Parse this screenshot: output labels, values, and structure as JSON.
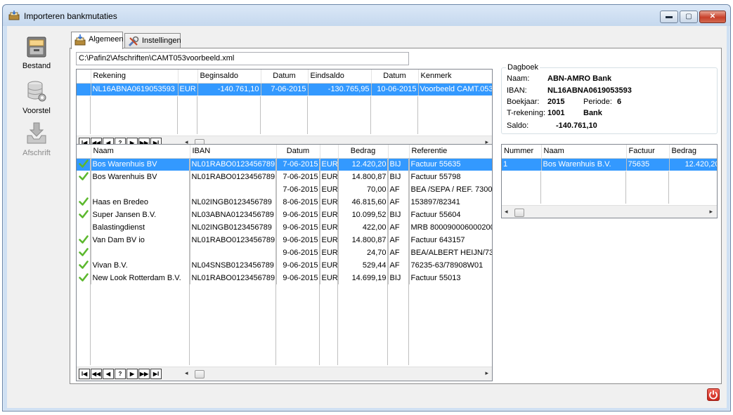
{
  "window": {
    "title": "Importeren bankmutaties",
    "controls": {
      "minimize": "▬",
      "maximize": "▢",
      "close": "✕"
    }
  },
  "sidebar": {
    "items": [
      {
        "label": "Bestand",
        "icon": "archive-box-icon",
        "enabled": true
      },
      {
        "label": "Voorstel",
        "icon": "database-gear-icon",
        "enabled": true
      },
      {
        "label": "Afschrift",
        "icon": "download-tray-icon",
        "enabled": false
      }
    ]
  },
  "tabs": [
    {
      "label": "Algemeen",
      "icon": "import-icon",
      "active": true
    },
    {
      "label": "Instellingen",
      "icon": "tools-icon",
      "active": false
    }
  ],
  "file_path": "C:\\Pafin2\\Afschriften\\CAMT053voorbeeld.xml",
  "statements": {
    "columns": [
      "Rekening",
      "Beginsaldo",
      "Datum",
      "Eindsaldo",
      "Datum",
      "Kenmerk"
    ],
    "rows": [
      {
        "rekening": "NL16ABNA0619053593",
        "valuta": "EUR",
        "beginsaldo": "-140.761,10",
        "datum1": "7-06-2015",
        "eindsaldo": "-130.765,95",
        "datum2": "10-06-2015",
        "kenmerk": "Voorbeeld CAMT.053"
      }
    ]
  },
  "navigator": {
    "buttons": [
      "I◀",
      "◀◀",
      "◀",
      "?",
      "▶",
      "▶▶",
      "▶I"
    ]
  },
  "dagboek": {
    "title": "Dagboek",
    "naam_label": "Naam:",
    "naam": "ABN-AMRO Bank",
    "iban_label": "IBAN:",
    "iban": "NL16ABNA0619053593",
    "boekjaar_label": "Boekjaar:",
    "boekjaar": "2015",
    "periode_label": "Periode:",
    "periode": "6",
    "trekening_label": "T-rekening:",
    "trekening": "1001",
    "trekening_naam": "Bank",
    "saldo_label": "Saldo:",
    "saldo": "-140.761,10"
  },
  "transactions": {
    "columns": [
      "Naam",
      "IBAN",
      "Datum",
      "Bedrag",
      "Referentie"
    ],
    "rows": [
      {
        "check": true,
        "naam": "Bos Warenhuis BV",
        "iban": "NL01RABO0123456789",
        "datum": "7-06-2015",
        "valuta": "EUR",
        "bedrag": "12.420,20",
        "bijaf": "BIJ",
        "referentie": "Factuur 55635",
        "selected": true
      },
      {
        "check": true,
        "naam": "Bos Warenhuis BV",
        "iban": "NL01RABO0123456789",
        "datum": "7-06-2015",
        "valuta": "EUR",
        "bedrag": "14.800,87",
        "bijaf": "BIJ",
        "referentie": "Factuur 55798"
      },
      {
        "check": false,
        "naam": "",
        "iban": "",
        "datum": "7-06-2015",
        "valuta": "EUR",
        "bedrag": "70,00",
        "bijaf": "AF",
        "referentie": "BEA /SEPA / REF. 7300"
      },
      {
        "check": true,
        "naam": "Haas en Bredeo",
        "iban": "NL02INGB0123456789",
        "datum": "8-06-2015",
        "valuta": "EUR",
        "bedrag": "46.815,60",
        "bijaf": "AF",
        "referentie": "153897/82341"
      },
      {
        "check": true,
        "naam": "Super Jansen B.V.",
        "iban": "NL03ABNA0123456789",
        "datum": "9-06-2015",
        "valuta": "EUR",
        "bedrag": "10.099,52",
        "bijaf": "BIJ",
        "referentie": "Factuur 55604"
      },
      {
        "check": false,
        "naam": "Balastingdienst",
        "iban": "NL02INGB0123456789",
        "datum": "9-06-2015",
        "valuta": "EUR",
        "bedrag": "422,00",
        "bijaf": "AF",
        "referentie": "MRB 800090006000200"
      },
      {
        "check": true,
        "naam": "Van Dam BV io",
        "iban": "NL01RABO0123456789",
        "datum": "9-06-2015",
        "valuta": "EUR",
        "bedrag": "14.800,87",
        "bijaf": "AF",
        "referentie": "Factuur 643157"
      },
      {
        "check": true,
        "naam": "",
        "iban": "",
        "datum": "9-06-2015",
        "valuta": "EUR",
        "bedrag": "24,70",
        "bijaf": "AF",
        "referentie": "BEA/ALBERT HEIJN/73"
      },
      {
        "check": true,
        "naam": "Vivan B.V.",
        "iban": "NL04SNSB0123456789",
        "datum": "9-06-2015",
        "valuta": "EUR",
        "bedrag": "529,44",
        "bijaf": "AF",
        "referentie": "76235-63/78908W01"
      },
      {
        "check": true,
        "naam": "New Look Rotterdam B.V.",
        "iban": "NL01RABO0123456789",
        "datum": "9-06-2015",
        "valuta": "EUR",
        "bedrag": "14.699,19",
        "bijaf": "BIJ",
        "referentie": "Factuur 55013"
      }
    ]
  },
  "matches": {
    "columns": [
      "Nummer",
      "Naam",
      "Factuur",
      "Bedrag"
    ],
    "rows": [
      {
        "nummer": "1",
        "naam": "Bos Warenhuis B.V.",
        "factuur": "75635",
        "bedrag": "12.420,20",
        "selected": true
      }
    ]
  },
  "colors": {
    "selection": "#3399ff",
    "check": "#5cb82e",
    "power": "#d4352a"
  }
}
